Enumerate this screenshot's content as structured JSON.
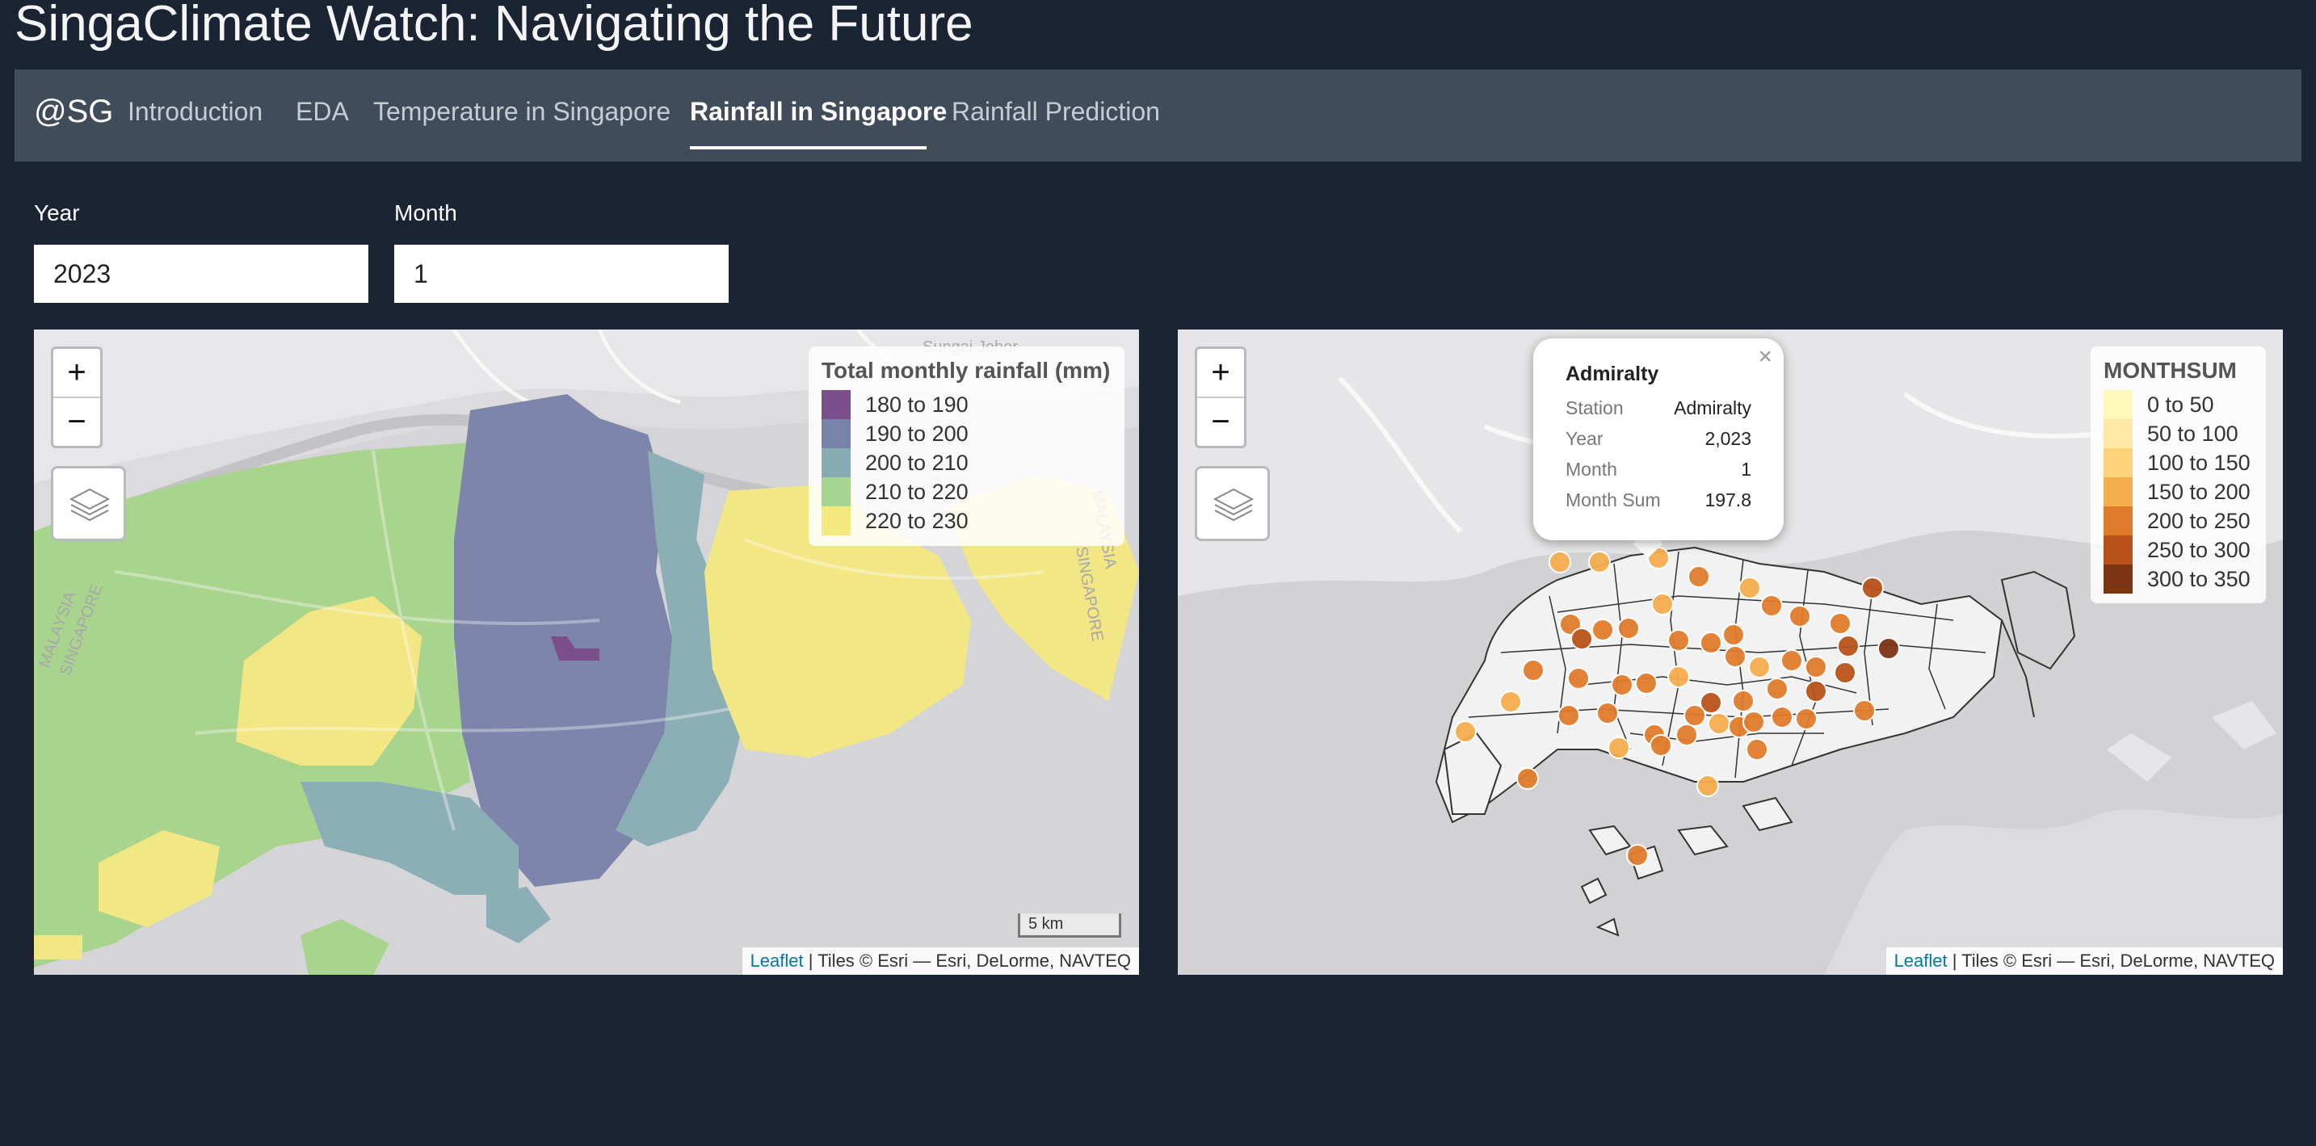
{
  "app": {
    "title": "SingaClimate Watch: Navigating the Future"
  },
  "nav": {
    "brand": "@SG",
    "items": [
      "Introduction",
      "EDA",
      "Temperature in Singapore",
      "Rainfall in Singapore",
      "Rainfall Prediction"
    ],
    "active": "Rainfall in Singapore"
  },
  "filters": {
    "year": {
      "label": "Year",
      "value": "2023"
    },
    "month": {
      "label": "Month",
      "value": "1"
    }
  },
  "map_common": {
    "zoom_in": "+",
    "zoom_out": "−",
    "attribution_link": "Leaflet",
    "attribution_text": " | Tiles © Esri — Esri, DeLorme, NAVTEQ"
  },
  "map_left": {
    "scale": "5 km",
    "legend": {
      "title": "Total monthly rainfall (mm)",
      "items": [
        {
          "label": "180 to 190",
          "color": "#7a4f8a"
        },
        {
          "label": "190 to 200",
          "color": "#7782a8"
        },
        {
          "label": "200 to 210",
          "color": "#88acb3"
        },
        {
          "label": "210 to 220",
          "color": "#a6d58f"
        },
        {
          "label": "220 to 230",
          "color": "#f5e87f"
        }
      ]
    },
    "basemap_labels": [
      "MALAYSIA",
      "SINGAPORE",
      "MALAYSIA",
      "SINGAPORE",
      "Sungai Johor"
    ]
  },
  "map_right": {
    "legend": {
      "title": "MONTHSUM",
      "items": [
        {
          "label": "0 to 50",
          "color": "#fff7bc"
        },
        {
          "label": "50 to 100",
          "color": "#fee8a4"
        },
        {
          "label": "100 to 150",
          "color": "#fdd27a"
        },
        {
          "label": "150 to 200",
          "color": "#f6ad4d"
        },
        {
          "label": "200 to 250",
          "color": "#e07b2b"
        },
        {
          "label": "250 to 300",
          "color": "#b9521a"
        },
        {
          "label": "300 to 350",
          "color": "#7d3412"
        }
      ]
    },
    "popup": {
      "title": "Admiralty",
      "close": "×",
      "rows": [
        {
          "key": "Station",
          "value": "Admiralty"
        },
        {
          "key": "Year",
          "value": "2,023"
        },
        {
          "key": "Month",
          "value": "1"
        },
        {
          "key": "Month Sum",
          "value": "197.8"
        }
      ]
    }
  }
}
